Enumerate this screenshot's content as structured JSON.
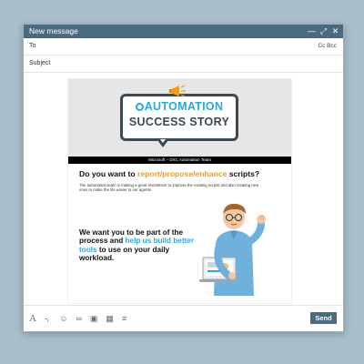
{
  "window": {
    "title": "New message",
    "controls": [
      "minimize-icon",
      "expand-icon",
      "close-icon"
    ]
  },
  "fields": {
    "to_label": "To",
    "cc_bcc": "Cc Bcc",
    "subject_label": "Subject"
  },
  "email": {
    "headline_line1": "AUTOMATION",
    "headline_line2": "SUCCESS STORY",
    "team_bar": "Microsoft – DXC Automation Team",
    "question_prefix": "Do you want to ",
    "question_highlight": "report/propose/enhance",
    "question_suffix": " scripts?",
    "paragraph": "The automation team is making a great investment to improve the existing scripts and also creating new ones to make the life easier to our agents.",
    "pitch_part1": "We want you to be part of the process and ",
    "pitch_highlight": "help us build better tools",
    "pitch_part2": " to use on your daily workload.",
    "colors": {
      "accent_blue": "#2aa7df",
      "accent_orange": "#f29c1f",
      "dark": "#3a4954"
    }
  },
  "toolbar": {
    "icons": [
      "font-format-icon",
      "attach-icon",
      "emoji-icon",
      "link-icon",
      "image-icon",
      "delete-icon",
      "more-icon"
    ],
    "send_label": "Send"
  }
}
